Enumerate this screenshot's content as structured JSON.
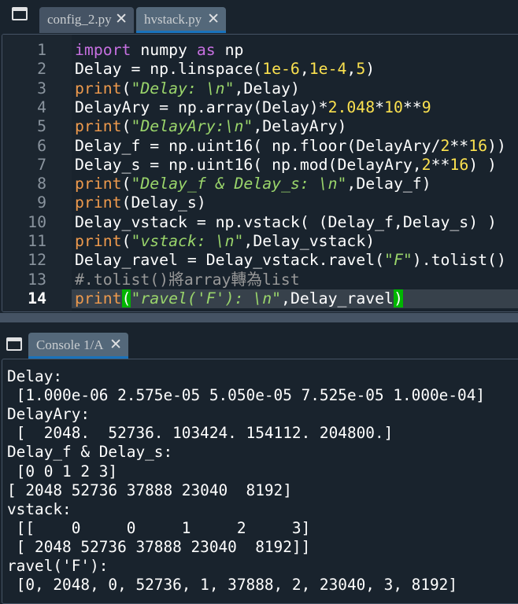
{
  "editor_tabs": [
    {
      "label": "config_2.py",
      "active": false
    },
    {
      "label": "hvstack.py",
      "active": true
    }
  ],
  "close_glyph": "✕",
  "code_lines": [
    {
      "n": "1",
      "tokens": [
        [
          "kw",
          "import"
        ],
        [
          "",
          "",
          " "
        ],
        [
          "",
          "numpy "
        ],
        [
          "kw",
          "as"
        ],
        [
          "",
          " np"
        ]
      ]
    },
    {
      "n": "2",
      "tokens": [
        [
          "",
          "Delay = np.linspace("
        ],
        [
          "nm",
          "1e-6"
        ],
        [
          "",
          ","
        ],
        [
          "nm",
          "1e-4"
        ],
        [
          "",
          ","
        ],
        [
          "nm",
          "5"
        ],
        [
          "",
          ")"
        ]
      ]
    },
    {
      "n": "3",
      "tokens": [
        [
          "bi",
          "print"
        ],
        [
          "",
          "("
        ],
        [
          "sq",
          "\""
        ],
        [
          "st",
          "Delay: \\n"
        ],
        [
          "sq",
          "\""
        ],
        [
          "",
          ",Delay)"
        ]
      ]
    },
    {
      "n": "4",
      "tokens": [
        [
          "",
          "DelayAry = np.array(Delay)*"
        ],
        [
          "nm",
          "2.048"
        ],
        [
          "",
          "*"
        ],
        [
          "nm",
          "10"
        ],
        [
          "",
          "**"
        ],
        [
          "nm",
          "9"
        ]
      ]
    },
    {
      "n": "5",
      "tokens": [
        [
          "bi",
          "print"
        ],
        [
          "",
          "("
        ],
        [
          "sq",
          "\""
        ],
        [
          "st",
          "DelayAry:\\n"
        ],
        [
          "sq",
          "\""
        ],
        [
          "",
          ",DelayAry)"
        ]
      ]
    },
    {
      "n": "6",
      "tokens": [
        [
          "",
          "Delay_f = np.uint16( np.floor(DelayAry/"
        ],
        [
          "nm",
          "2"
        ],
        [
          "",
          "**"
        ],
        [
          "nm",
          "16"
        ],
        [
          "",
          "))"
        ]
      ]
    },
    {
      "n": "7",
      "tokens": [
        [
          "",
          "Delay_s = np.uint16( np.mod(DelayAry,"
        ],
        [
          "nm",
          "2"
        ],
        [
          "",
          "**"
        ],
        [
          "nm",
          "16"
        ],
        [
          "",
          ") )"
        ]
      ]
    },
    {
      "n": "8",
      "tokens": [
        [
          "bi",
          "print"
        ],
        [
          "",
          "("
        ],
        [
          "sq",
          "\""
        ],
        [
          "st",
          "Delay_f & Delay_s: \\n"
        ],
        [
          "sq",
          "\""
        ],
        [
          "",
          ",Delay_f)"
        ]
      ]
    },
    {
      "n": "9",
      "tokens": [
        [
          "bi",
          "print"
        ],
        [
          "",
          "(Delay_s)"
        ]
      ]
    },
    {
      "n": "10",
      "tokens": [
        [
          "",
          "Delay_vstack = np.vstack( (Delay_f,Delay_s) )"
        ]
      ]
    },
    {
      "n": "11",
      "tokens": [
        [
          "bi",
          "print"
        ],
        [
          "",
          "("
        ],
        [
          "sq",
          "\""
        ],
        [
          "st",
          "vstack: \\n"
        ],
        [
          "sq",
          "\""
        ],
        [
          "",
          ",Delay_vstack)"
        ]
      ]
    },
    {
      "n": "12",
      "tokens": [
        [
          "",
          "Delay_ravel = Delay_vstack.ravel("
        ],
        [
          "sq",
          "\""
        ],
        [
          "st",
          "F"
        ],
        [
          "sq",
          "\""
        ],
        [
          "",
          ").tolist()"
        ]
      ]
    },
    {
      "n": "13",
      "tokens": [
        [
          "cm",
          "#.tolist()將array轉為list"
        ]
      ]
    },
    {
      "n": "14",
      "current": true,
      "tokens": [
        [
          "bi",
          "print"
        ],
        [
          "br",
          "("
        ],
        [
          "sq",
          "\""
        ],
        [
          "st",
          "ravel('F'): \\n"
        ],
        [
          "sq",
          "\""
        ],
        [
          "",
          ",Delay_ravel"
        ],
        [
          "br",
          ")"
        ]
      ]
    }
  ],
  "console_tab": {
    "label": "Console 1/A"
  },
  "console_lines": [
    "Delay:",
    " [1.000e-06 2.575e-05 5.050e-05 7.525e-05 1.000e-04]",
    "DelayAry:",
    " [  2048.  52736. 103424. 154112. 204800.]",
    "Delay_f & Delay_s:",
    " [0 0 1 2 3]",
    "[ 2048 52736 37888 23040  8192]",
    "vstack:",
    " [[    0     0     1     2     3]",
    " [ 2048 52736 37888 23040  8192]]",
    "ravel('F'):",
    " [0, 2048, 0, 52736, 1, 37888, 2, 23040, 3, 8192]"
  ]
}
